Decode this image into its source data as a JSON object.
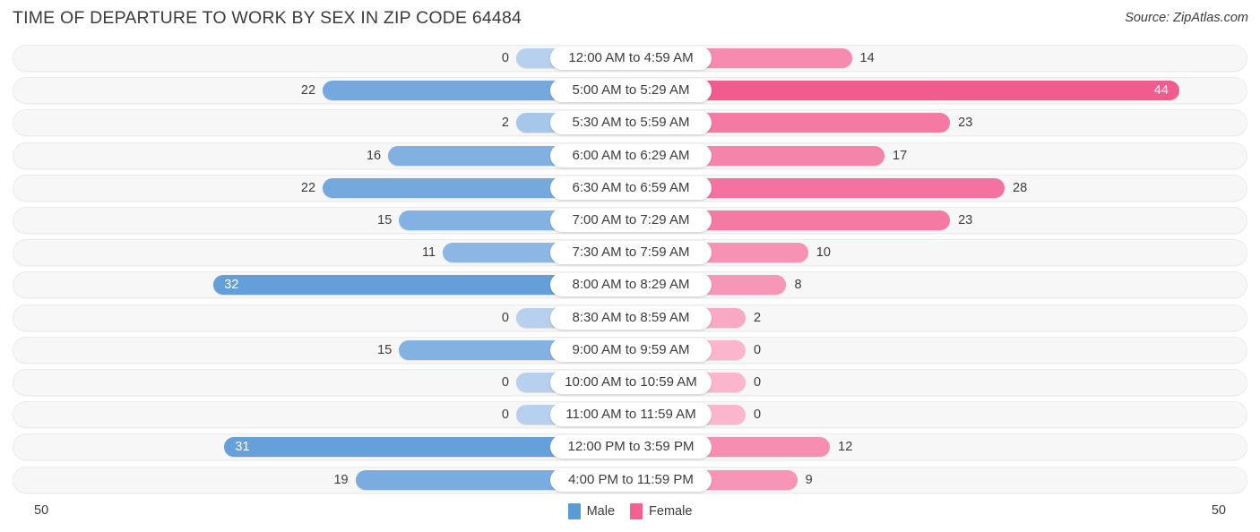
{
  "header": {
    "title": "TIME OF DEPARTURE TO WORK BY SEX IN ZIP CODE 64484",
    "source": "Source: ZipAtlas.com"
  },
  "legend": {
    "male_label": "Male",
    "female_label": "Female",
    "male_color": "#5b9bd5",
    "female_color": "#f4608f"
  },
  "axis": {
    "left_max_label": "50",
    "right_max_label": "50"
  },
  "chart_data": {
    "type": "bar",
    "title": "TIME OF DEPARTURE TO WORK BY SEX IN ZIP CODE 64484",
    "orientation": "horizontal-diverging",
    "xlabel": "",
    "ylabel": "",
    "xlim": [
      0,
      50
    ],
    "grid": false,
    "legend_position": "bottom-center",
    "categories": [
      "12:00 AM to 4:59 AM",
      "5:00 AM to 5:29 AM",
      "5:30 AM to 5:59 AM",
      "6:00 AM to 6:29 AM",
      "6:30 AM to 6:59 AM",
      "7:00 AM to 7:29 AM",
      "7:30 AM to 7:59 AM",
      "8:00 AM to 8:29 AM",
      "8:30 AM to 8:59 AM",
      "9:00 AM to 9:59 AM",
      "10:00 AM to 10:59 AM",
      "11:00 AM to 11:59 AM",
      "12:00 PM to 3:59 PM",
      "4:00 PM to 11:59 PM"
    ],
    "series": [
      {
        "name": "Male",
        "side": "left",
        "color": "#5b9bd5",
        "values": [
          0,
          22,
          2,
          16,
          22,
          15,
          11,
          32,
          0,
          15,
          0,
          0,
          31,
          19
        ]
      },
      {
        "name": "Female",
        "side": "right",
        "color": "#f4608f",
        "values": [
          14,
          44,
          23,
          17,
          28,
          23,
          10,
          8,
          2,
          0,
          0,
          0,
          12,
          9
        ]
      }
    ]
  }
}
